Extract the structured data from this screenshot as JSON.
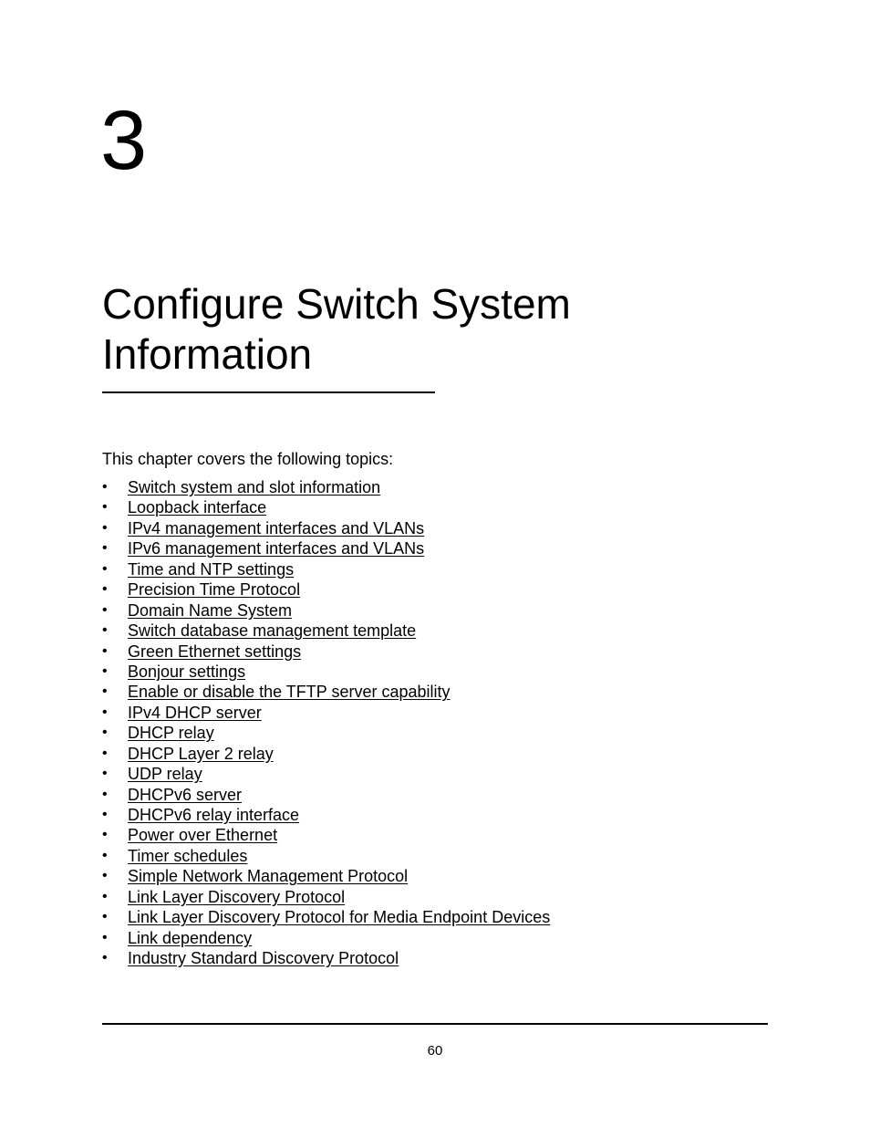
{
  "chapter": {
    "number": "3",
    "title": "Configure Switch System Information"
  },
  "intro": "This chapter covers the following topics:",
  "bullet_glyph": "•",
  "topics": [
    "Switch system and slot information",
    "Loopback interface",
    "IPv4 management interfaces and VLANs",
    "IPv6 management interfaces and VLANs",
    "Time and NTP settings",
    "Precision Time Protocol",
    "Domain Name System",
    "Switch database management template",
    "Green Ethernet settings",
    "Bonjour settings",
    "Enable or disable the TFTP server capability",
    "IPv4 DHCP server",
    "DHCP relay",
    "DHCP Layer 2 relay",
    "UDP relay",
    "DHCPv6 server",
    "DHCPv6 relay interface",
    "Power over Ethernet",
    "Timer schedules",
    "Simple Network Management Protocol",
    "Link Layer Discovery Protocol",
    "Link Layer Discovery Protocol for Media Endpoint Devices",
    "Link dependency",
    "Industry Standard Discovery Protocol"
  ],
  "footer": {
    "page_number": "60"
  }
}
